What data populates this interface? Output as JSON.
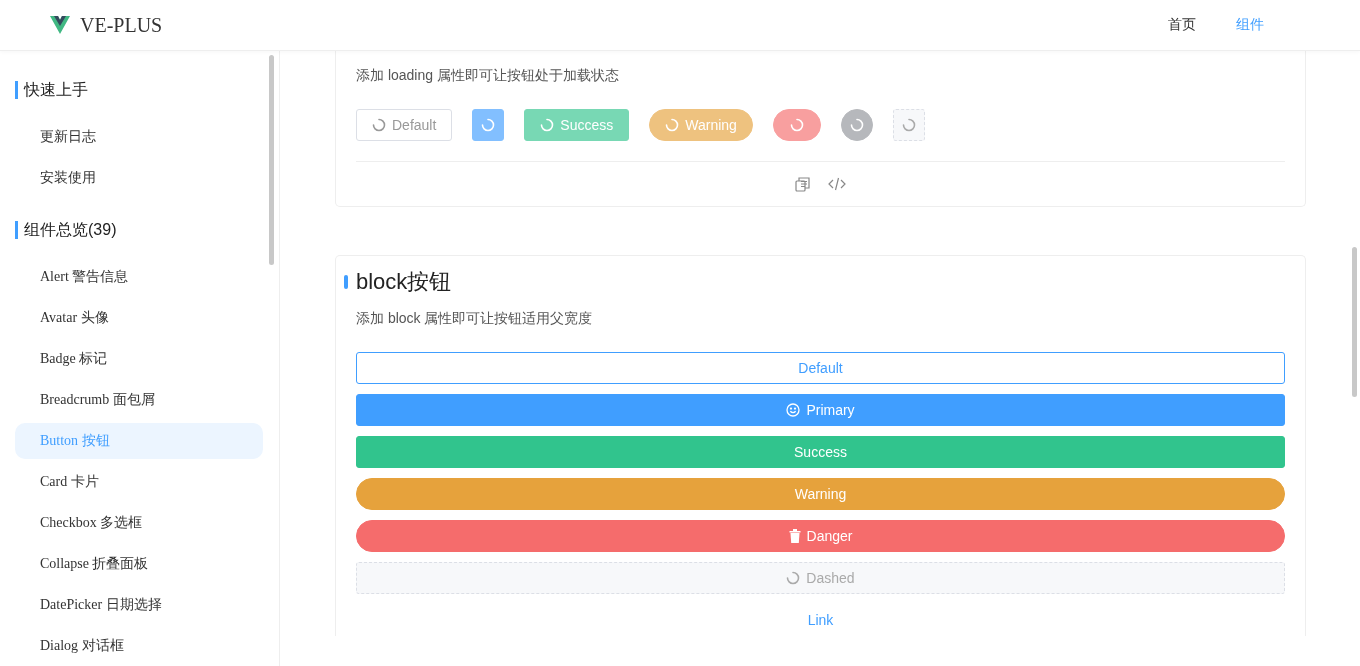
{
  "header": {
    "logo": "VE-PLUS",
    "nav": [
      {
        "label": "首页",
        "selected": false
      },
      {
        "label": "组件",
        "selected": true
      }
    ]
  },
  "sidebar": {
    "groups": [
      {
        "title": "快速上手",
        "items": [
          {
            "label": "更新日志",
            "selected": false
          },
          {
            "label": "安装使用",
            "selected": false
          }
        ]
      },
      {
        "title": "组件总览(39)",
        "items": [
          {
            "label": "Alert 警告信息",
            "selected": false
          },
          {
            "label": "Avatar 头像",
            "selected": false
          },
          {
            "label": "Badge 标记",
            "selected": false
          },
          {
            "label": "Breadcrumb 面包屑",
            "selected": false
          },
          {
            "label": "Button 按钮",
            "selected": true
          },
          {
            "label": "Card 卡片",
            "selected": false
          },
          {
            "label": "Checkbox 多选框",
            "selected": false
          },
          {
            "label": "Collapse 折叠面板",
            "selected": false
          },
          {
            "label": "DatePicker 日期选择",
            "selected": false
          },
          {
            "label": "Dialog 对话框",
            "selected": false
          }
        ]
      }
    ]
  },
  "loading_demo": {
    "description": "添加 loading 属性即可让按钮处于加载状态",
    "buttons": [
      {
        "kind": "default",
        "round": false,
        "label": "Default",
        "loading": true
      },
      {
        "kind": "primary",
        "round": false,
        "loading": true
      },
      {
        "kind": "success",
        "round": false,
        "label": "Success",
        "loading": true
      },
      {
        "kind": "warning",
        "round": true,
        "label": "Warning",
        "loading": true
      },
      {
        "kind": "danger",
        "round": true,
        "loading": true
      },
      {
        "kind": "info",
        "round": true,
        "loading": true
      },
      {
        "kind": "dashed",
        "round": false,
        "loading": true
      }
    ]
  },
  "block_demo": {
    "title": "block按钮",
    "description": "添加 block 属性即可让按钮适用父宽度",
    "buttons": [
      {
        "kind": "default",
        "round": false,
        "label": "Default",
        "loading": false
      },
      {
        "kind": "primary",
        "round": false,
        "label": "Primary",
        "loading": false
      },
      {
        "kind": "success",
        "round": false,
        "label": "Success",
        "loading": false
      },
      {
        "kind": "warning",
        "round": true,
        "label": "Warning",
        "loading": false
      },
      {
        "kind": "danger",
        "round": true,
        "label": "Danger",
        "loading": false
      },
      {
        "kind": "dashed",
        "round": false,
        "label": "Dashed",
        "loading": true
      },
      {
        "kind": "link",
        "label": "Link",
        "loading": false
      }
    ]
  }
}
